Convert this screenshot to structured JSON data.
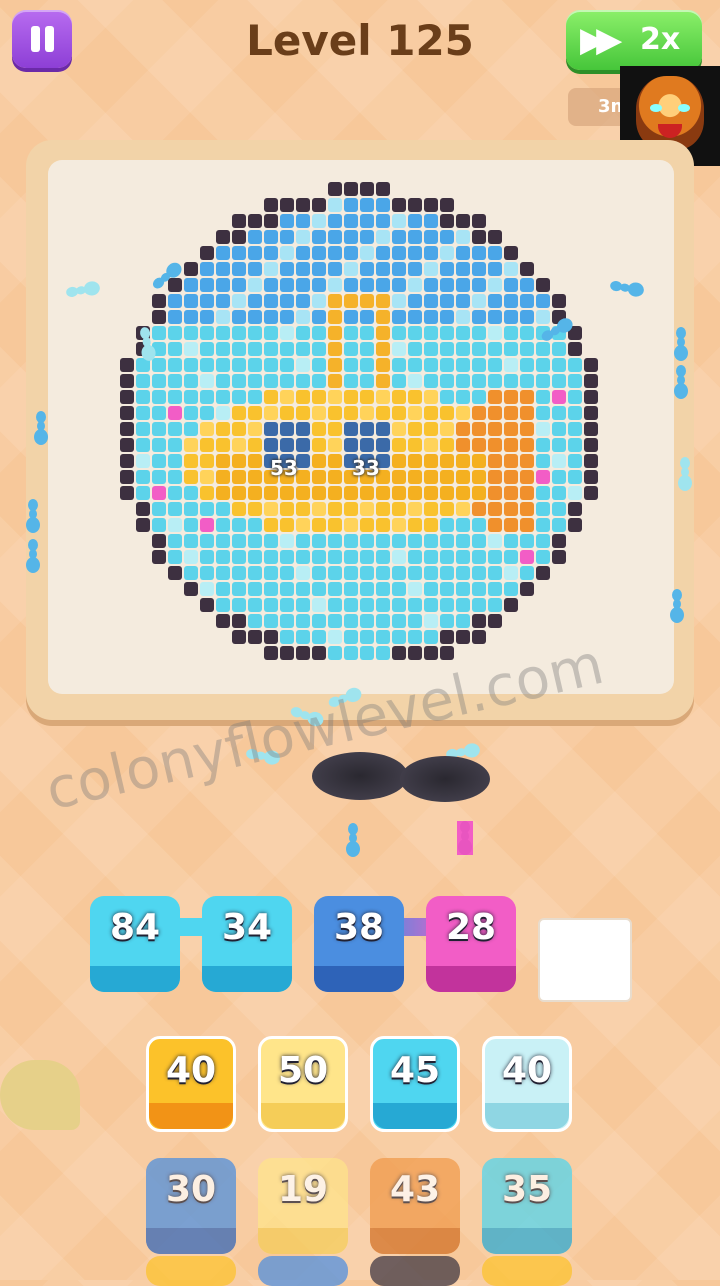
{
  "header": {
    "level_title": "Level 125",
    "speed_label": "2x",
    "timer_text": "3m"
  },
  "icons": {
    "pause": "pause-icon",
    "speed": "fast-forward-icon",
    "avatar": "tiger-avatar-icon"
  },
  "board": {
    "pixel_labels": [
      "53",
      "33"
    ]
  },
  "watermark": "colonyflowlevel.com",
  "queue": {
    "tiles": [
      {
        "value": "84",
        "color": "#4fd6f0"
      },
      {
        "value": "34",
        "color": "#4fd6f0"
      },
      {
        "value": "38",
        "color": "#4b8ee0"
      },
      {
        "value": "28",
        "color": "#f25dc6"
      }
    ],
    "empty_slots": 1
  },
  "grid": {
    "rows": [
      [
        {
          "value": "40",
          "color": "yellow"
        },
        {
          "value": "50",
          "color": "paleyellow"
        },
        {
          "value": "45",
          "color": "cyan"
        },
        {
          "value": "40",
          "color": "palecyan"
        }
      ],
      [
        {
          "value": "30",
          "color": "blue"
        },
        {
          "value": "19",
          "color": "paleyellow"
        },
        {
          "value": "43",
          "color": "orange"
        },
        {
          "value": "35",
          "color": "cyan"
        }
      ]
    ]
  },
  "colors": {
    "accent_purple": "#8d3fd6",
    "accent_green": "#46c63a",
    "title_brown": "#6a3e1a",
    "background": "#f7c89a"
  }
}
